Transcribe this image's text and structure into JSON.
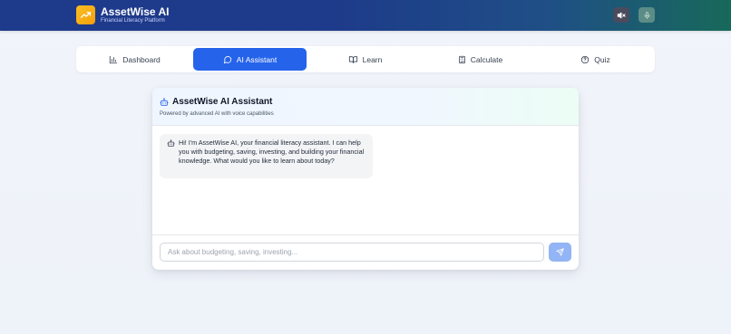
{
  "header": {
    "title": "AssetWise AI",
    "subtitle": "Financial Literacy Platform",
    "logo_icon": "trending-up-icon",
    "mute_icon": "volume-mute-icon",
    "mic_icon": "microphone-icon"
  },
  "tabs": [
    {
      "label": "Dashboard",
      "icon": "bar-chart-icon",
      "active": false
    },
    {
      "label": "AI Assistant",
      "icon": "message-circle-icon",
      "active": true
    },
    {
      "label": "Learn",
      "icon": "book-open-icon",
      "active": false
    },
    {
      "label": "Calculate",
      "icon": "calculator-icon",
      "active": false
    },
    {
      "label": "Quiz",
      "icon": "quiz-icon",
      "active": false
    }
  ],
  "chat": {
    "title": "AssetWise AI Assistant",
    "subtitle": "Powered by advanced AI with voice capabilities",
    "messages": [
      {
        "sender": "assistant",
        "icon": "bot-icon",
        "text": "Hi! I'm AssetWise AI, your financial literacy assistant. I can help you with budgeting, saving, investing, and building your financial knowledge. What would you like to learn about today?"
      }
    ],
    "input": {
      "placeholder": "Ask about budgeting, saving, investing...",
      "value": ""
    },
    "send_icon": "send-icon"
  },
  "colors": {
    "header_start": "#1e3a8a",
    "header_end": "#17695a",
    "accent": "#2563eb",
    "logo": "#f59e0b",
    "send_disabled": "#93b4f5"
  }
}
